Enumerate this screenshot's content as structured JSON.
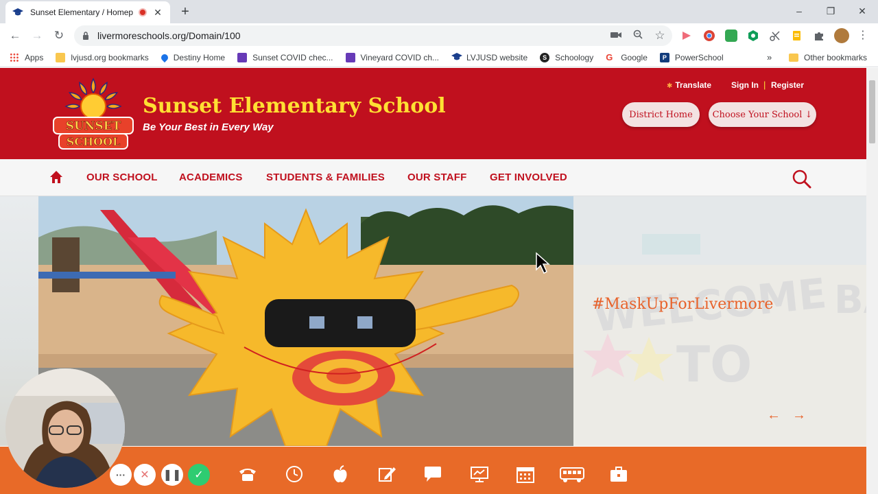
{
  "browser": {
    "tab_title": "Sunset Elementary / Homepa",
    "new_tab": "+",
    "url": "livermoreschools.org/Domain/100",
    "window": {
      "minimize": "–",
      "restore": "❐",
      "close": "✕"
    },
    "bookmarks": [
      {
        "label": "Apps",
        "icon": "apps-grid-icon",
        "color": "#4285f4"
      },
      {
        "label": "lvjusd.org bookmarks",
        "icon": "folder-icon",
        "color": "#f9c74f"
      },
      {
        "label": "Destiny Home",
        "icon": "destiny-icon",
        "color": "#1a73e8"
      },
      {
        "label": "Sunset COVID chec...",
        "icon": "form-icon",
        "color": "#673ab7"
      },
      {
        "label": "Vineyard COVID ch...",
        "icon": "form-icon",
        "color": "#673ab7"
      },
      {
        "label": "LVJUSD website",
        "icon": "mortarboard-icon",
        "color": "#1a3e8c"
      },
      {
        "label": "Schoology",
        "icon": "schoology-icon",
        "color": "#222222"
      },
      {
        "label": "Google",
        "icon": "google-icon",
        "color": "#ea4335"
      },
      {
        "label": "PowerSchool",
        "icon": "powerschool-icon",
        "color": "#123c7c"
      }
    ],
    "bookmarks_overflow": "»",
    "other_bookmarks": "Other bookmarks"
  },
  "site": {
    "school_name": "Sunset Elementary School",
    "tagline": "Be Your Best in Every Way",
    "logo_text_top": "SUNSET",
    "logo_text_bottom": "SCHOOL",
    "translate": "Translate",
    "sign_in": "Sign In",
    "separator": "|",
    "register": "Register",
    "district_home": "District Home",
    "choose_school": "Choose Your School ↓",
    "nav": [
      "OUR SCHOOL",
      "ACADEMICS",
      "STUDENTS & FAMILIES",
      "OUR STAFF",
      "GET INVOLVED"
    ],
    "hero_hashtag": "#MaskUpForLivermore",
    "hero_prev": "←",
    "hero_next": "→"
  },
  "colors": {
    "brand_red": "#c0101e",
    "brand_yellow": "#ffe033",
    "accent_orange": "#e86a28"
  },
  "quick_links": [
    "phone-icon",
    "clock-icon",
    "apple-icon",
    "edit-icon",
    "chat-icon",
    "presentation-icon",
    "calendar-icon",
    "bus-icon",
    "briefcase-icon"
  ],
  "recorder_controls": [
    "more-icon",
    "cancel-icon",
    "pause-icon",
    "done-icon"
  ]
}
